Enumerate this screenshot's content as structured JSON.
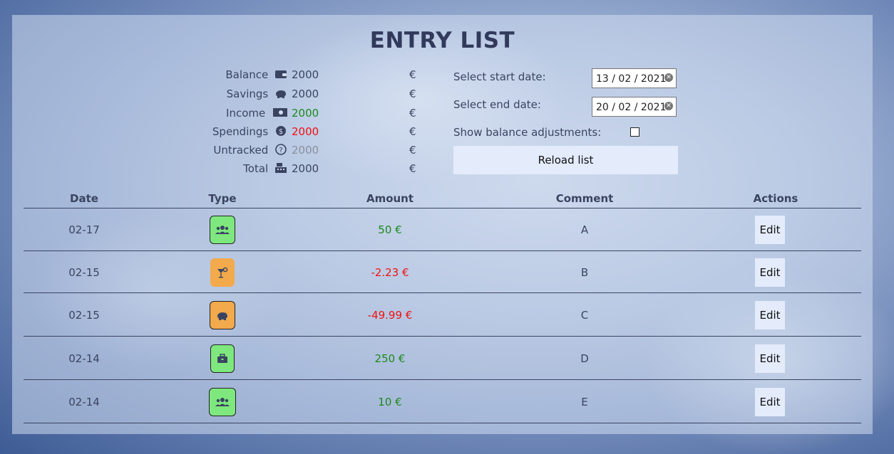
{
  "page": {
    "title": "ENTRY LIST"
  },
  "summary": [
    {
      "label": "Balance",
      "icon": "wallet-icon",
      "value": "2000",
      "currency": "€",
      "color": "#3a4460"
    },
    {
      "label": "Savings",
      "icon": "piggy-bank-icon",
      "value": "2000",
      "currency": "€",
      "color": "#3a4460"
    },
    {
      "label": "Income",
      "icon": "money-bill-icon",
      "value": "2000",
      "currency": "€",
      "color": "#1c8a1c"
    },
    {
      "label": "Spendings",
      "icon": "coin-comment-icon",
      "value": "2000",
      "currency": "€",
      "color": "#ee1111"
    },
    {
      "label": "Untracked",
      "icon": "question-circle-icon",
      "value": "2000",
      "currency": "€",
      "color": "#8a8f9c"
    },
    {
      "label": "Total",
      "icon": "cash-register-icon",
      "value": "2000",
      "currency": "€",
      "color": "#3a4460"
    }
  ],
  "filters": {
    "start_label": "Select start date:",
    "start_value": "13 / 02 / 2021",
    "end_label": "Select end date:",
    "end_value": "20 / 02 / 2021",
    "adjust_label": "Show balance adjustments:",
    "adjust_checked": false,
    "reload_label": "Reload list"
  },
  "table": {
    "headers": {
      "date": "Date",
      "type": "Type",
      "amount": "Amount",
      "comment": "Comment",
      "actions": "Actions"
    },
    "rows": [
      {
        "date": "02-17",
        "type_icon": "users-icon",
        "type_color": "#7ee87e",
        "amount": "50 €",
        "amount_color": "#1c8a1c",
        "comment": "A",
        "action": "Edit"
      },
      {
        "date": "02-15",
        "type_icon": "cocktail-icon",
        "type_color": "#f2aa4c",
        "amount": "-2.23 €",
        "amount_color": "#ee1111",
        "comment": "B",
        "action": "Edit"
      },
      {
        "date": "02-15",
        "type_icon": "piggy-bank-icon",
        "type_color": "#f2aa4c",
        "amount": "-49.99 €",
        "amount_color": "#ee1111",
        "comment": "C",
        "action": "Edit"
      },
      {
        "date": "02-14",
        "type_icon": "briefcase-icon",
        "type_color": "#7ee87e",
        "amount": "250 €",
        "amount_color": "#1c8a1c",
        "comment": "D",
        "action": "Edit"
      },
      {
        "date": "02-14",
        "type_icon": "users-icon",
        "type_color": "#7ee87e",
        "amount": "10 €",
        "amount_color": "#1c8a1c",
        "comment": "E",
        "action": "Edit"
      }
    ]
  }
}
